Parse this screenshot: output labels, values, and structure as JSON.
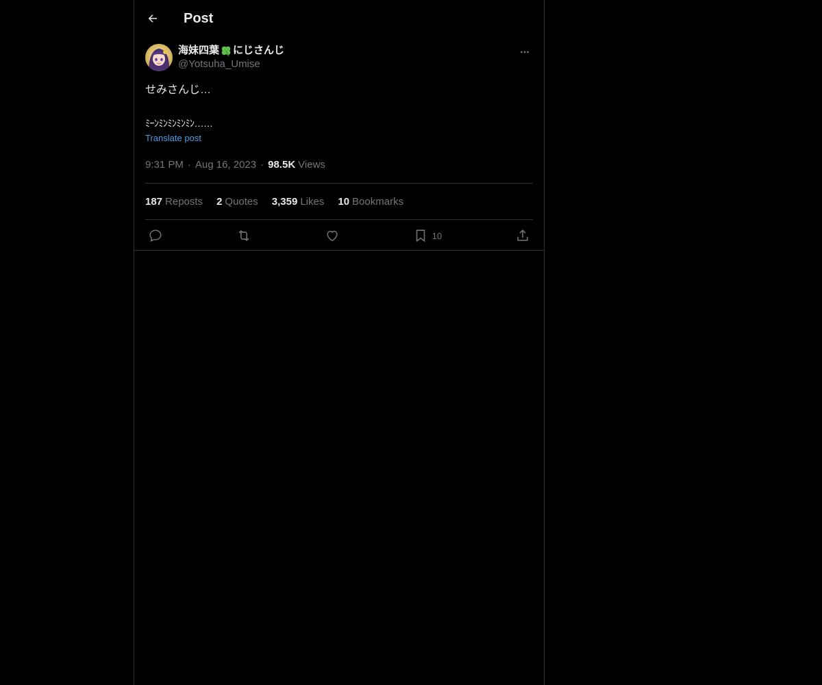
{
  "header": {
    "back_icon": "arrow-left-icon",
    "title": "Post"
  },
  "author": {
    "name_part1": "海妹四葉",
    "clover_icon": "four-leaf-clover-icon",
    "name_part2": "にじさんじ",
    "handle": "@Yotsuha_Umise"
  },
  "post": {
    "line1": "せみさんじ…",
    "line2": "ﾐｰﾝﾐﾝﾐﾝﾐﾝﾐﾝ……",
    "translate_label": "Translate post",
    "time": "9:31 PM",
    "date": "Aug 16, 2023",
    "views_count": "98.5K",
    "views_label": "Views"
  },
  "stats": {
    "reposts_count": "187",
    "reposts_label": "Reposts",
    "quotes_count": "2",
    "quotes_label": "Quotes",
    "likes_count": "3,359",
    "likes_label": "Likes",
    "bookmarks_count": "10",
    "bookmarks_label": "Bookmarks"
  },
  "actions": {
    "bookmark_count": "10"
  },
  "colors": {
    "background": "#000000",
    "text_primary": "#e7e9ea",
    "text_secondary": "#71767b",
    "link": "#4b9ee6",
    "border": "#2f3336",
    "clover": "#5fbf4f"
  }
}
